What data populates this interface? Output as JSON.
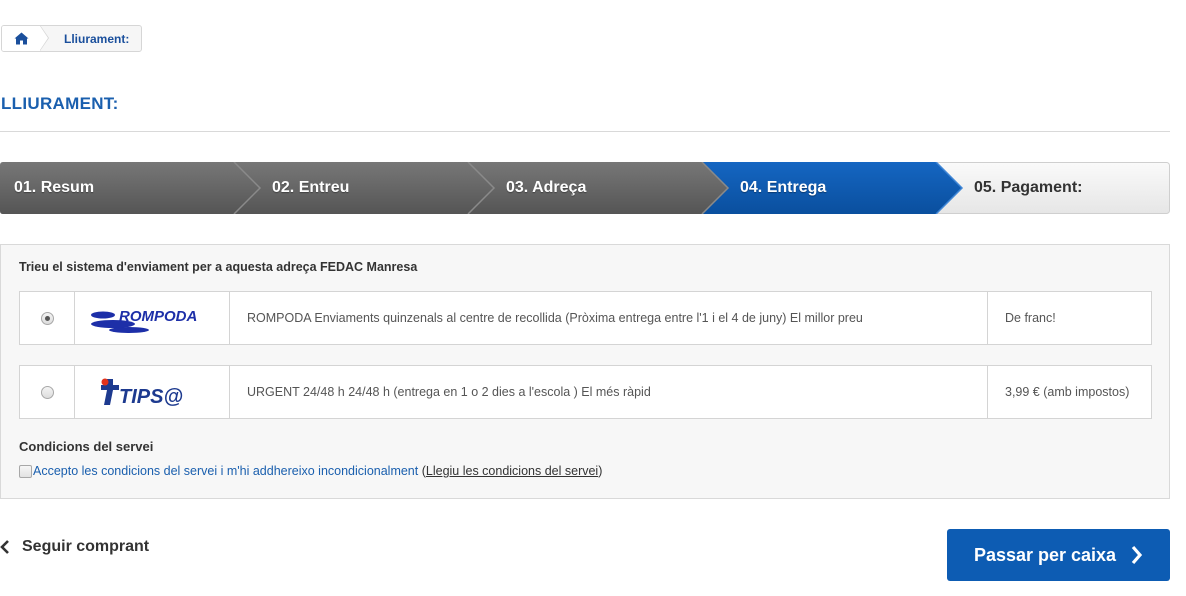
{
  "breadcrumb": {
    "home_icon": "home-icon",
    "current": "Lliurament:"
  },
  "page_title": "LLIURAMENT:",
  "steps": [
    {
      "label": "01. Resum",
      "state": "done"
    },
    {
      "label": "02. Entreu",
      "state": "done"
    },
    {
      "label": "03. Adreça",
      "state": "done"
    },
    {
      "label": "04. Entrega",
      "state": "active"
    },
    {
      "label": "05. Pagament:",
      "state": "pending"
    }
  ],
  "colors": {
    "done": "#666666",
    "active": "#0d5cb3",
    "pending": "#f2f2f2",
    "title": "#1a5fae"
  },
  "shipping": {
    "heading": "Trieu el sistema d'enviament per a aquesta adreça FEDAC Manresa",
    "options": [
      {
        "logo": "ROMPODA",
        "description": "ROMPODA Enviaments quinzenals al centre de recollida (Pròxima entrega entre l'1 i el 4 de juny) El millor preu",
        "price": "De franc!",
        "selected": true
      },
      {
        "logo": "TIPS@",
        "description": "URGENT 24/48 h 24/48 h (entrega en 1 o 2 dies a l'escola ) El més ràpid",
        "price": "3,99 € (amb impostos)",
        "selected": false
      }
    ]
  },
  "conditions": {
    "title": "Condicions del servei",
    "accept_text": "Accepto les condicions del servei i m'hi addhereixo incondicionalment",
    "open_paren": " (",
    "link_text": "Llegiu les condicions del servei",
    "close_paren": ")"
  },
  "footer": {
    "back_label": "Seguir comprant",
    "checkout_label": "Passar per caixa"
  }
}
